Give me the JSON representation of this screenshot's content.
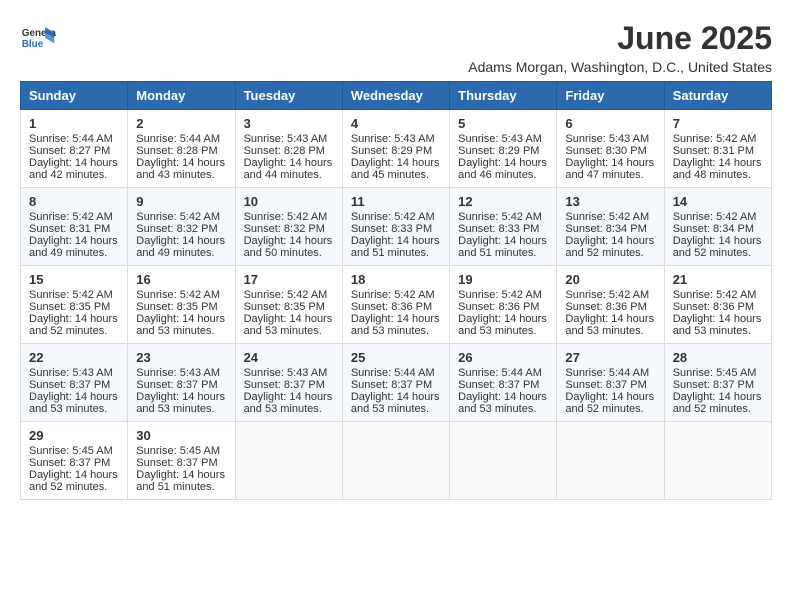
{
  "header": {
    "logo_line1": "General",
    "logo_line2": "Blue",
    "title": "June 2025",
    "subtitle": "Adams Morgan, Washington, D.C., United States"
  },
  "days_of_week": [
    "Sunday",
    "Monday",
    "Tuesday",
    "Wednesday",
    "Thursday",
    "Friday",
    "Saturday"
  ],
  "weeks": [
    [
      {
        "day": "1",
        "lines": [
          "Sunrise: 5:44 AM",
          "Sunset: 8:27 PM",
          "Daylight: 14 hours",
          "and 42 minutes."
        ]
      },
      {
        "day": "2",
        "lines": [
          "Sunrise: 5:44 AM",
          "Sunset: 8:28 PM",
          "Daylight: 14 hours",
          "and 43 minutes."
        ]
      },
      {
        "day": "3",
        "lines": [
          "Sunrise: 5:43 AM",
          "Sunset: 8:28 PM",
          "Daylight: 14 hours",
          "and 44 minutes."
        ]
      },
      {
        "day": "4",
        "lines": [
          "Sunrise: 5:43 AM",
          "Sunset: 8:29 PM",
          "Daylight: 14 hours",
          "and 45 minutes."
        ]
      },
      {
        "day": "5",
        "lines": [
          "Sunrise: 5:43 AM",
          "Sunset: 8:29 PM",
          "Daylight: 14 hours",
          "and 46 minutes."
        ]
      },
      {
        "day": "6",
        "lines": [
          "Sunrise: 5:43 AM",
          "Sunset: 8:30 PM",
          "Daylight: 14 hours",
          "and 47 minutes."
        ]
      },
      {
        "day": "7",
        "lines": [
          "Sunrise: 5:42 AM",
          "Sunset: 8:31 PM",
          "Daylight: 14 hours",
          "and 48 minutes."
        ]
      }
    ],
    [
      {
        "day": "8",
        "lines": [
          "Sunrise: 5:42 AM",
          "Sunset: 8:31 PM",
          "Daylight: 14 hours",
          "and 49 minutes."
        ]
      },
      {
        "day": "9",
        "lines": [
          "Sunrise: 5:42 AM",
          "Sunset: 8:32 PM",
          "Daylight: 14 hours",
          "and 49 minutes."
        ]
      },
      {
        "day": "10",
        "lines": [
          "Sunrise: 5:42 AM",
          "Sunset: 8:32 PM",
          "Daylight: 14 hours",
          "and 50 minutes."
        ]
      },
      {
        "day": "11",
        "lines": [
          "Sunrise: 5:42 AM",
          "Sunset: 8:33 PM",
          "Daylight: 14 hours",
          "and 51 minutes."
        ]
      },
      {
        "day": "12",
        "lines": [
          "Sunrise: 5:42 AM",
          "Sunset: 8:33 PM",
          "Daylight: 14 hours",
          "and 51 minutes."
        ]
      },
      {
        "day": "13",
        "lines": [
          "Sunrise: 5:42 AM",
          "Sunset: 8:34 PM",
          "Daylight: 14 hours",
          "and 52 minutes."
        ]
      },
      {
        "day": "14",
        "lines": [
          "Sunrise: 5:42 AM",
          "Sunset: 8:34 PM",
          "Daylight: 14 hours",
          "and 52 minutes."
        ]
      }
    ],
    [
      {
        "day": "15",
        "lines": [
          "Sunrise: 5:42 AM",
          "Sunset: 8:35 PM",
          "Daylight: 14 hours",
          "and 52 minutes."
        ]
      },
      {
        "day": "16",
        "lines": [
          "Sunrise: 5:42 AM",
          "Sunset: 8:35 PM",
          "Daylight: 14 hours",
          "and 53 minutes."
        ]
      },
      {
        "day": "17",
        "lines": [
          "Sunrise: 5:42 AM",
          "Sunset: 8:35 PM",
          "Daylight: 14 hours",
          "and 53 minutes."
        ]
      },
      {
        "day": "18",
        "lines": [
          "Sunrise: 5:42 AM",
          "Sunset: 8:36 PM",
          "Daylight: 14 hours",
          "and 53 minutes."
        ]
      },
      {
        "day": "19",
        "lines": [
          "Sunrise: 5:42 AM",
          "Sunset: 8:36 PM",
          "Daylight: 14 hours",
          "and 53 minutes."
        ]
      },
      {
        "day": "20",
        "lines": [
          "Sunrise: 5:42 AM",
          "Sunset: 8:36 PM",
          "Daylight: 14 hours",
          "and 53 minutes."
        ]
      },
      {
        "day": "21",
        "lines": [
          "Sunrise: 5:42 AM",
          "Sunset: 8:36 PM",
          "Daylight: 14 hours",
          "and 53 minutes."
        ]
      }
    ],
    [
      {
        "day": "22",
        "lines": [
          "Sunrise: 5:43 AM",
          "Sunset: 8:37 PM",
          "Daylight: 14 hours",
          "and 53 minutes."
        ]
      },
      {
        "day": "23",
        "lines": [
          "Sunrise: 5:43 AM",
          "Sunset: 8:37 PM",
          "Daylight: 14 hours",
          "and 53 minutes."
        ]
      },
      {
        "day": "24",
        "lines": [
          "Sunrise: 5:43 AM",
          "Sunset: 8:37 PM",
          "Daylight: 14 hours",
          "and 53 minutes."
        ]
      },
      {
        "day": "25",
        "lines": [
          "Sunrise: 5:44 AM",
          "Sunset: 8:37 PM",
          "Daylight: 14 hours",
          "and 53 minutes."
        ]
      },
      {
        "day": "26",
        "lines": [
          "Sunrise: 5:44 AM",
          "Sunset: 8:37 PM",
          "Daylight: 14 hours",
          "and 53 minutes."
        ]
      },
      {
        "day": "27",
        "lines": [
          "Sunrise: 5:44 AM",
          "Sunset: 8:37 PM",
          "Daylight: 14 hours",
          "and 52 minutes."
        ]
      },
      {
        "day": "28",
        "lines": [
          "Sunrise: 5:45 AM",
          "Sunset: 8:37 PM",
          "Daylight: 14 hours",
          "and 52 minutes."
        ]
      }
    ],
    [
      {
        "day": "29",
        "lines": [
          "Sunrise: 5:45 AM",
          "Sunset: 8:37 PM",
          "Daylight: 14 hours",
          "and 52 minutes."
        ]
      },
      {
        "day": "30",
        "lines": [
          "Sunrise: 5:45 AM",
          "Sunset: 8:37 PM",
          "Daylight: 14 hours",
          "and 51 minutes."
        ]
      },
      {
        "day": "",
        "lines": []
      },
      {
        "day": "",
        "lines": []
      },
      {
        "day": "",
        "lines": []
      },
      {
        "day": "",
        "lines": []
      },
      {
        "day": "",
        "lines": []
      }
    ]
  ]
}
